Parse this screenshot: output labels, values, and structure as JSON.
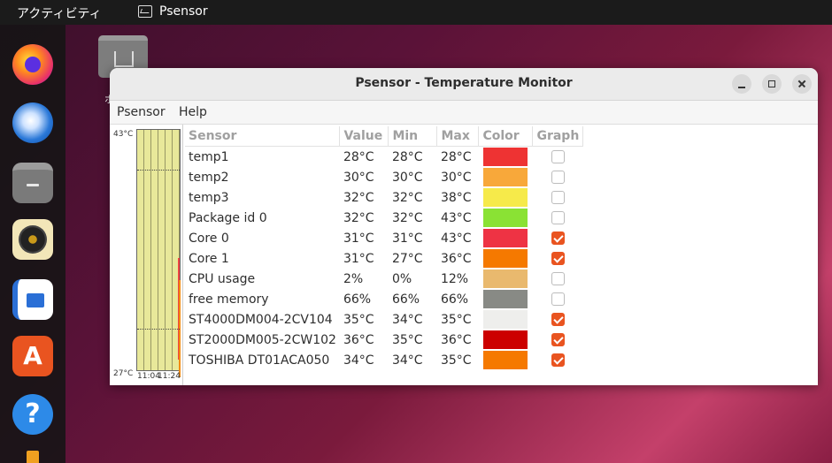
{
  "topbar": {
    "activities": "アクティビティ",
    "app_name": "Psensor"
  },
  "dock": [
    "firefox-icon",
    "thunderbird-icon",
    "files-icon",
    "rhythmbox-icon",
    "libreoffice-writer-icon",
    "software-icon",
    "help-icon"
  ],
  "desktop": {
    "home_label": "ホ"
  },
  "window": {
    "title": "Psensor - Temperature Monitor",
    "menu": {
      "file": "Psensor",
      "help": "Help"
    },
    "graph": {
      "y_max": "43°C",
      "y_min": "27°C",
      "x_start": "11:04",
      "x_end": "11:24"
    },
    "columns": {
      "sensor": "Sensor",
      "value": "Value",
      "min": "Min",
      "max": "Max",
      "color": "Color",
      "graph": "Graph"
    },
    "rows": [
      {
        "name": "temp1",
        "value": "28°C",
        "min": "28°C",
        "max": "28°C",
        "color": "#ee3333",
        "graph": false
      },
      {
        "name": "temp2",
        "value": "30°C",
        "min": "30°C",
        "max": "30°C",
        "color": "#f8a83a",
        "graph": false
      },
      {
        "name": "temp3",
        "value": "32°C",
        "min": "32°C",
        "max": "38°C",
        "color": "#f6ea4a",
        "graph": false
      },
      {
        "name": "Package id 0",
        "value": "32°C",
        "min": "32°C",
        "max": "43°C",
        "color": "#8ae234",
        "graph": false
      },
      {
        "name": "Core 0",
        "value": "31°C",
        "min": "31°C",
        "max": "43°C",
        "color": "#ee3344",
        "graph": true
      },
      {
        "name": "Core 1",
        "value": "31°C",
        "min": "27°C",
        "max": "36°C",
        "color": "#f57900",
        "graph": true
      },
      {
        "name": "CPU usage",
        "value": "2%",
        "min": "0%",
        "max": "12%",
        "color": "#e9b96e",
        "graph": false
      },
      {
        "name": "free memory",
        "value": "66%",
        "min": "66%",
        "max": "66%",
        "color": "#888a85",
        "graph": false
      },
      {
        "name": "ST4000DM004-2CV104",
        "value": "35°C",
        "min": "34°C",
        "max": "35°C",
        "color": "#eeeeec",
        "graph": true
      },
      {
        "name": "ST2000DM005-2CW102",
        "value": "36°C",
        "min": "35°C",
        "max": "36°C",
        "color": "#cc0000",
        "graph": true
      },
      {
        "name": "TOSHIBA DT01ACA050",
        "value": "34°C",
        "min": "34°C",
        "max": "35°C",
        "color": "#f57900",
        "graph": true
      }
    ]
  }
}
